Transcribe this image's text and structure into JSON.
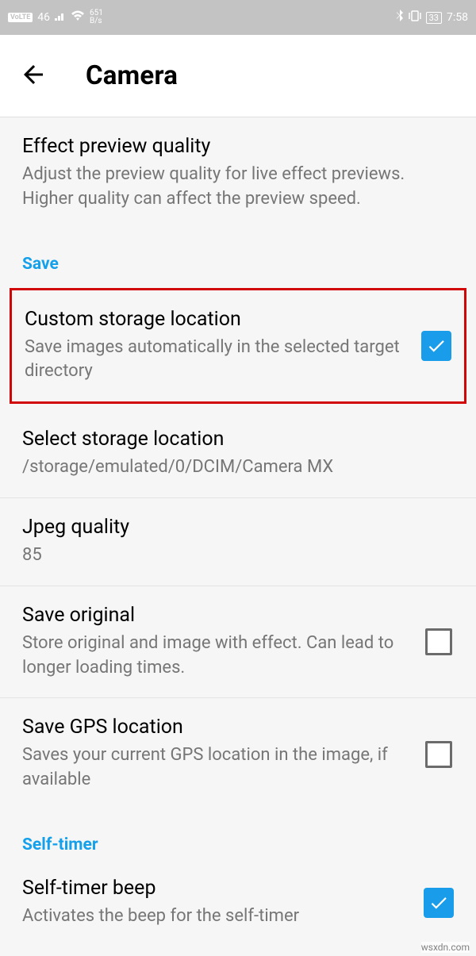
{
  "statusBar": {
    "volte": "VoLTE",
    "signal": "46",
    "netSpeed": "651",
    "netUnit": "B/s",
    "battery": "33",
    "time": "7:58"
  },
  "appBar": {
    "title": "Camera"
  },
  "sections": {
    "effectPreview": {
      "title": "Effect preview quality",
      "subtitle": "Adjust the preview quality for live effect previews. Higher quality can affect the preview speed."
    },
    "saveHeader": "Save",
    "customStorage": {
      "title": "Custom storage location",
      "subtitle": "Save images automatically in the selected target directory"
    },
    "selectStorage": {
      "title": "Select storage location",
      "subtitle": "/storage/emulated/0/DCIM/Camera MX"
    },
    "jpegQuality": {
      "title": "Jpeg quality",
      "subtitle": "85"
    },
    "saveOriginal": {
      "title": "Save original",
      "subtitle": "Store original and image with effect. Can lead to longer loading times."
    },
    "saveGps": {
      "title": "Save GPS location",
      "subtitle": "Saves your current GPS location in the image, if available"
    },
    "selfTimerHeader": "Self-timer",
    "selfTimerBeep": {
      "title": "Self-timer beep",
      "subtitle": "Activates the beep for the self-timer"
    }
  },
  "watermark": "wsxdn.com"
}
